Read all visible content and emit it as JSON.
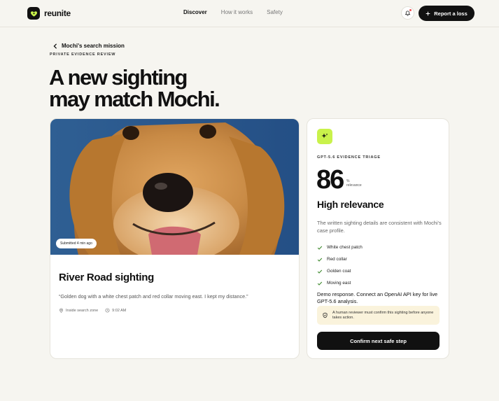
{
  "app": {
    "name": "reunite"
  },
  "nav": {
    "items": [
      {
        "label": "Discover"
      },
      {
        "label": "How it works"
      },
      {
        "label": "Safety"
      }
    ]
  },
  "header": {
    "report_label": "Report a loss"
  },
  "page": {
    "back_label": "Mochi's search mission",
    "eyebrow": "PRIVATE EVIDENCE REVIEW",
    "headline_line1": "A new sighting",
    "headline_line2": "may match Mochi."
  },
  "sighting": {
    "badge": "Submitted 4 min ago",
    "title": "River Road sighting",
    "quote": "“Golden dog with a white chest patch and red collar moving east. I kept my distance.”",
    "location": "Inside search zone",
    "time": "9:02 AM"
  },
  "triage": {
    "label": "GPT-5.6 EVIDENCE TRIAGE",
    "score": "86",
    "score_unit": "%",
    "score_caption": "relevance",
    "relevance_title": "High relevance",
    "description": "The written sighting details are consistent with Mochi's case profile.",
    "matches": [
      "White chest patch",
      "Red collar",
      "Golden coat",
      "Moving east"
    ],
    "demo_note": "Demo response. Connect an OpenAI API key for live GPT-5.6 analysis.",
    "notice": "A human reviewer must confirm this sighting before anyone takes action.",
    "confirm_label": "Confirm next safe step"
  },
  "colors": {
    "accent": "#c9f24b",
    "dark": "#111111",
    "notice_bg": "#faf3dc",
    "background": "#f6f5f0"
  }
}
